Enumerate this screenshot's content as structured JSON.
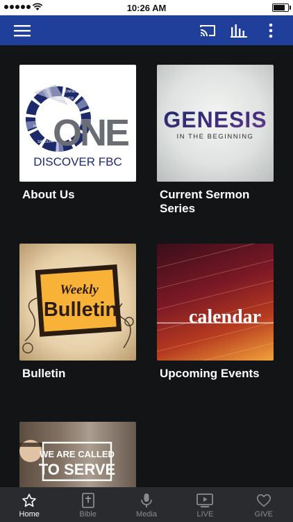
{
  "status": {
    "time": "10:26 AM",
    "battery_level": 0.95
  },
  "appbar": {
    "menu_icon": "hamburger-icon",
    "cast_icon": "cast-icon",
    "audio_icon": "audio-bars-icon",
    "more_icon": "more-vertical-icon",
    "color": "#1f3f9a"
  },
  "tiles": [
    {
      "label": "About Us",
      "image": {
        "big": "ONE",
        "sub": "DISCOVER FBC",
        "ring": [
          "SAPULPA",
          "FBC",
          "DISCOVER",
          "CONNECT",
          "SERVE"
        ]
      }
    },
    {
      "label": "Current Sermon Series",
      "image": {
        "big": "GENESIS",
        "sub": "IN THE BEGINNING"
      }
    },
    {
      "label": "Bulletin",
      "image": {
        "line1": "Weekly",
        "line2": "Bulletin"
      }
    },
    {
      "label": "Upcoming Events",
      "image": {
        "word": "calendar"
      }
    },
    {
      "label": "",
      "image": {
        "line1": "WE ARE CALLED",
        "line2": "TO SERVE"
      }
    }
  ],
  "tabs": [
    {
      "label": "Home",
      "icon": "star-icon",
      "active": true
    },
    {
      "label": "Bible",
      "icon": "bible-icon",
      "active": false
    },
    {
      "label": "Media",
      "icon": "microphone-icon",
      "active": false
    },
    {
      "label": "LIVE",
      "icon": "live-tv-icon",
      "active": false
    },
    {
      "label": "GIVE",
      "icon": "heart-icon",
      "active": false
    }
  ],
  "colors": {
    "background": "#131416",
    "tabbar": "#2a2b2e",
    "active": "#ffffff",
    "inactive": "#8a8b8f"
  }
}
